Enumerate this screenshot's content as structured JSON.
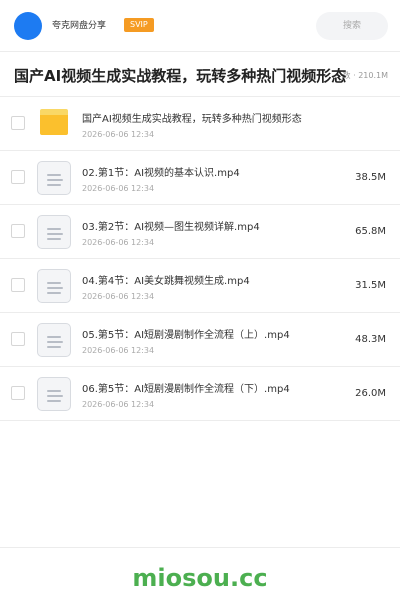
{
  "header": {
    "username": "夸克网盘分享",
    "badge": "SVIP",
    "search_placeholder": "搜索",
    "avatar_color": "#1d7bf2",
    "badge_color": "#f59b23"
  },
  "share": {
    "title": "国产AI视频生成实战教程，玩转多种热门视频形态",
    "meta_prefix": "数",
    "meta_sep": "·",
    "total_size": "210.1M"
  },
  "files": [
    {
      "type": "folder",
      "name": "国产AI视频生成实战教程，玩转多种热门视频形态",
      "date": "2026-06-06 12:34",
      "size": ""
    },
    {
      "type": "file",
      "name": "02.第1节：AI视频的基本认识.mp4",
      "date": "2026-06-06 12:34",
      "size": "38.5M"
    },
    {
      "type": "file",
      "name": "03.第2节：AI视频—图生视频详解.mp4",
      "date": "2026-06-06 12:34",
      "size": "65.8M"
    },
    {
      "type": "file",
      "name": "04.第4节：AI美女跳舞视频生成.mp4",
      "date": "2026-06-06 12:34",
      "size": "31.5M"
    },
    {
      "type": "file",
      "name": "05.第5节：AI短剧漫剧制作全流程（上）.mp4",
      "date": "2026-06-06 12:34",
      "size": "48.3M"
    },
    {
      "type": "file",
      "name": "06.第5节：AI短剧漫剧制作全流程（下）.mp4",
      "date": "2026-06-06 12:34",
      "size": "26.0M"
    }
  ],
  "footer": {
    "watermark": "miosou.cc",
    "watermark_color": "#4caf50"
  }
}
